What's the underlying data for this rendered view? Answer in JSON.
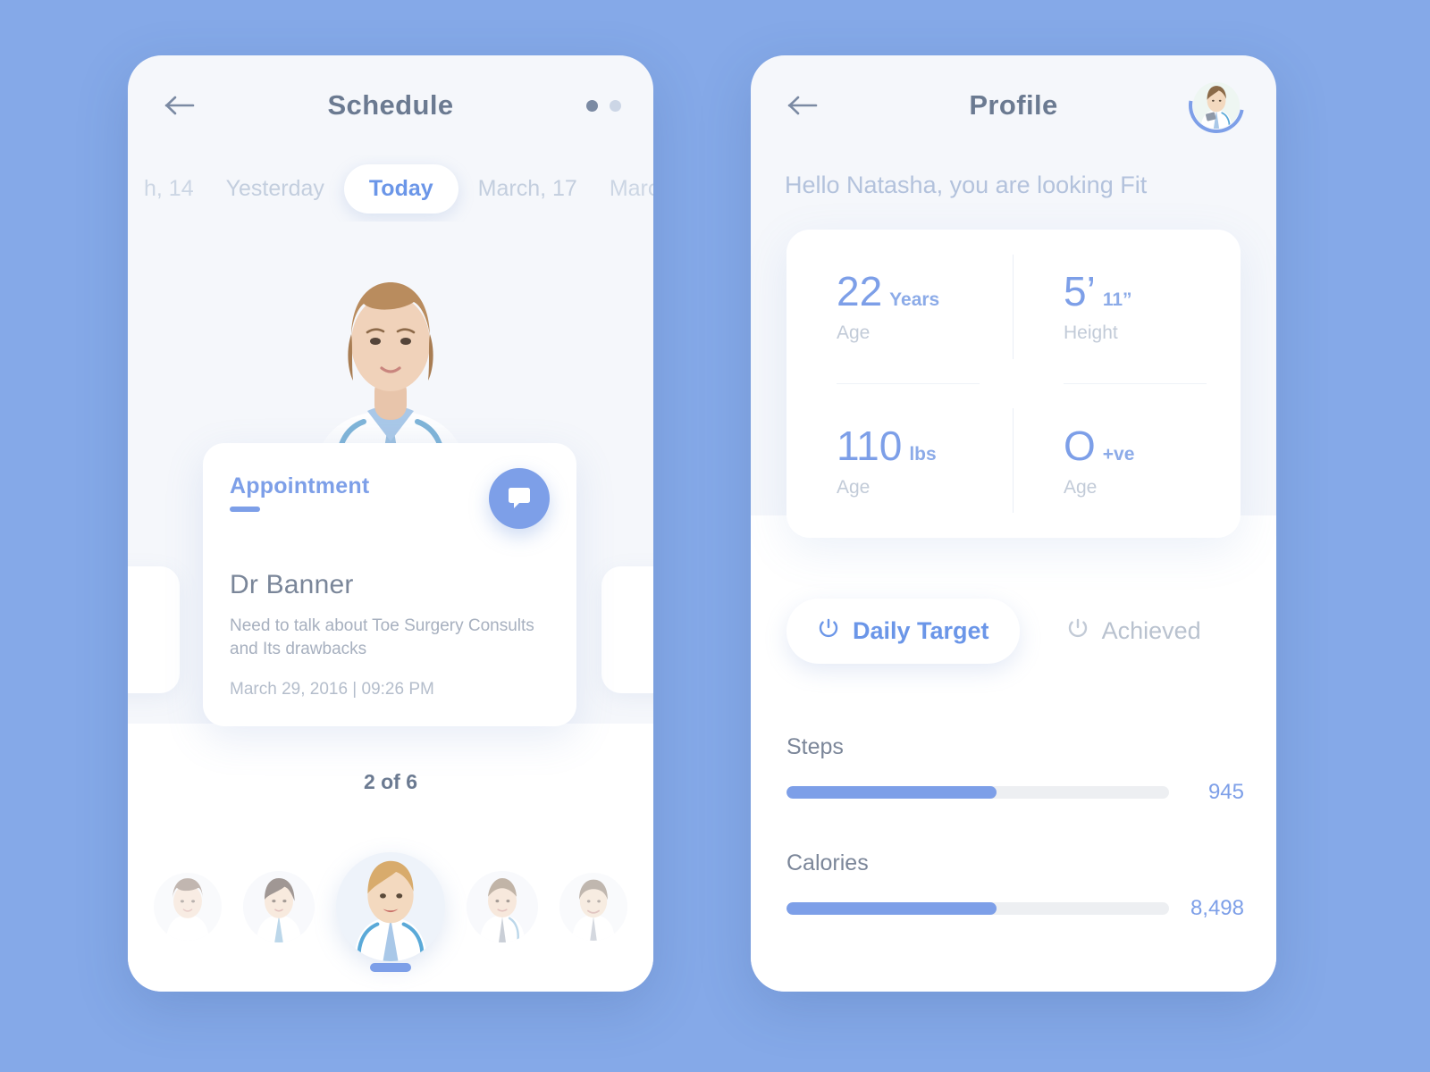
{
  "theme": {
    "background": "#85a9e8",
    "accent": "#7d9fe8",
    "accent_text": "#6b96e8",
    "card": "#ffffff",
    "panel": "#f5f7fb",
    "muted": "#b3c2dc"
  },
  "schedule": {
    "title": "Schedule",
    "back_icon": "arrow-left-icon",
    "page_dots": 2,
    "dates": [
      {
        "label": "h, 14",
        "state": "clipped"
      },
      {
        "label": "Yesterday",
        "state": "inactive"
      },
      {
        "label": "Today",
        "state": "active"
      },
      {
        "label": "March, 17",
        "state": "inactive"
      },
      {
        "label": "March",
        "state": "clipped"
      }
    ],
    "appointment": {
      "label": "Appointment",
      "chat_icon": "chat-bubble-icon",
      "doctor": "Dr Banner",
      "description": "Need to talk about Toe Surgery Consults and Its drawbacks",
      "datetime": "March 29, 2016  |  09:26 PM"
    },
    "counter": "2 of 6",
    "avatars": [
      {
        "name": "doctor-1",
        "size": "small"
      },
      {
        "name": "doctor-2",
        "size": "mid"
      },
      {
        "name": "doctor-3",
        "size": "big"
      },
      {
        "name": "doctor-4",
        "size": "mid"
      },
      {
        "name": "doctor-5",
        "size": "small"
      }
    ]
  },
  "profile": {
    "title": "Profile",
    "back_icon": "arrow-left-icon",
    "avatar_icon": "user-avatar-icon",
    "greeting": "Hello Natasha, you are looking Fit",
    "stats": [
      {
        "value": "22",
        "unit": "Years",
        "caption": "Age"
      },
      {
        "value": "5’",
        "unit": "11”",
        "caption": "Height"
      },
      {
        "value": "110",
        "unit": "lbs",
        "caption": "Age"
      },
      {
        "value": "O",
        "unit": "+ve",
        "caption": "Age"
      }
    ],
    "tabs": [
      {
        "label": "Daily Target",
        "icon": "power-target-icon",
        "active": true
      },
      {
        "label": "Achieved",
        "icon": "power-target-icon",
        "active": false
      }
    ],
    "progress": [
      {
        "title": "Steps",
        "value": "945",
        "percent": 55
      },
      {
        "title": "Calories",
        "value": "8,498",
        "percent": 55
      }
    ]
  }
}
